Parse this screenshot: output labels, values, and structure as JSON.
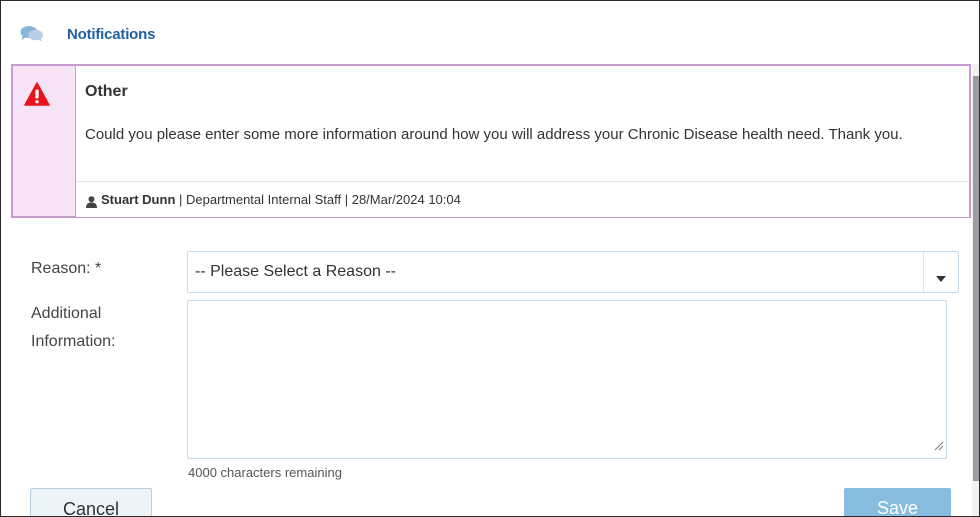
{
  "header": {
    "title": "Notifications",
    "icon": "chat-bubbles-icon"
  },
  "notification": {
    "title": "Other",
    "body": "Could you please enter some more information around how you will address your Chronic Disease health need. Thank you.",
    "author": "Stuart Dunn",
    "meta": " | Departmental Internal Staff | 28/Mar/2024 10:04",
    "icon": "warning-triangle-icon",
    "colors": {
      "border": "#c79bd2",
      "gutter": "#f6e3f6",
      "warning": "#e8141b"
    }
  },
  "form": {
    "reason_label": "Reason: *",
    "reason_value": "-- Please Select a Reason --",
    "additional_label_1": "Additional",
    "additional_label_2": "Information:",
    "additional_value": "",
    "counter": "4000 characters remaining"
  },
  "buttons": {
    "cancel": "Cancel",
    "save": "Save"
  },
  "colors": {
    "title": "#2261a6",
    "save_bg": "#88bde0"
  }
}
